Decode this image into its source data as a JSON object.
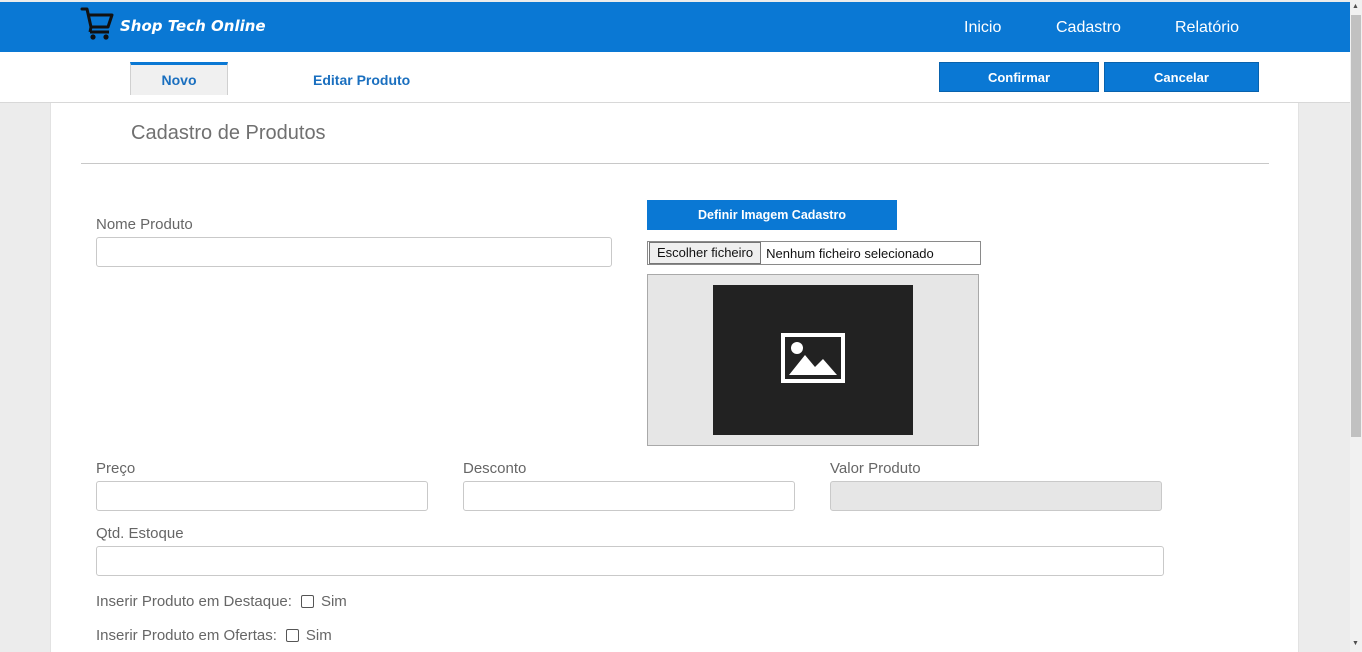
{
  "brand": {
    "name": "Shop Tech Online",
    "icon": "shopping-cart-icon"
  },
  "nav": {
    "items": [
      "Inicio",
      "Cadastro",
      "Relatório"
    ]
  },
  "tabs": {
    "novo": "Novo",
    "editar": "Editar Produto"
  },
  "actions": {
    "confirm": "Confirmar",
    "cancel": "Cancelar"
  },
  "page": {
    "title": "Cadastro de Produtos"
  },
  "form": {
    "nome_label": "Nome Produto",
    "nome_value": "",
    "image_button": "Definir Imagem Cadastro",
    "file_button": "Escolher ficheiro",
    "file_status": "Nenhum ficheiro selecionado",
    "image_icon": "image-placeholder-icon",
    "preco_label": "Preço",
    "desconto_label": "Desconto",
    "valor_label": "Valor Produto",
    "estoque_label": "Qtd. Estoque",
    "destaque_label": "Inserir Produto em Destaque:",
    "ofertas_label": "Inserir Produto em Ofertas:",
    "sim_label": "Sim"
  },
  "colors": {
    "primary": "#0a78d4",
    "link": "#1a6fbf"
  }
}
